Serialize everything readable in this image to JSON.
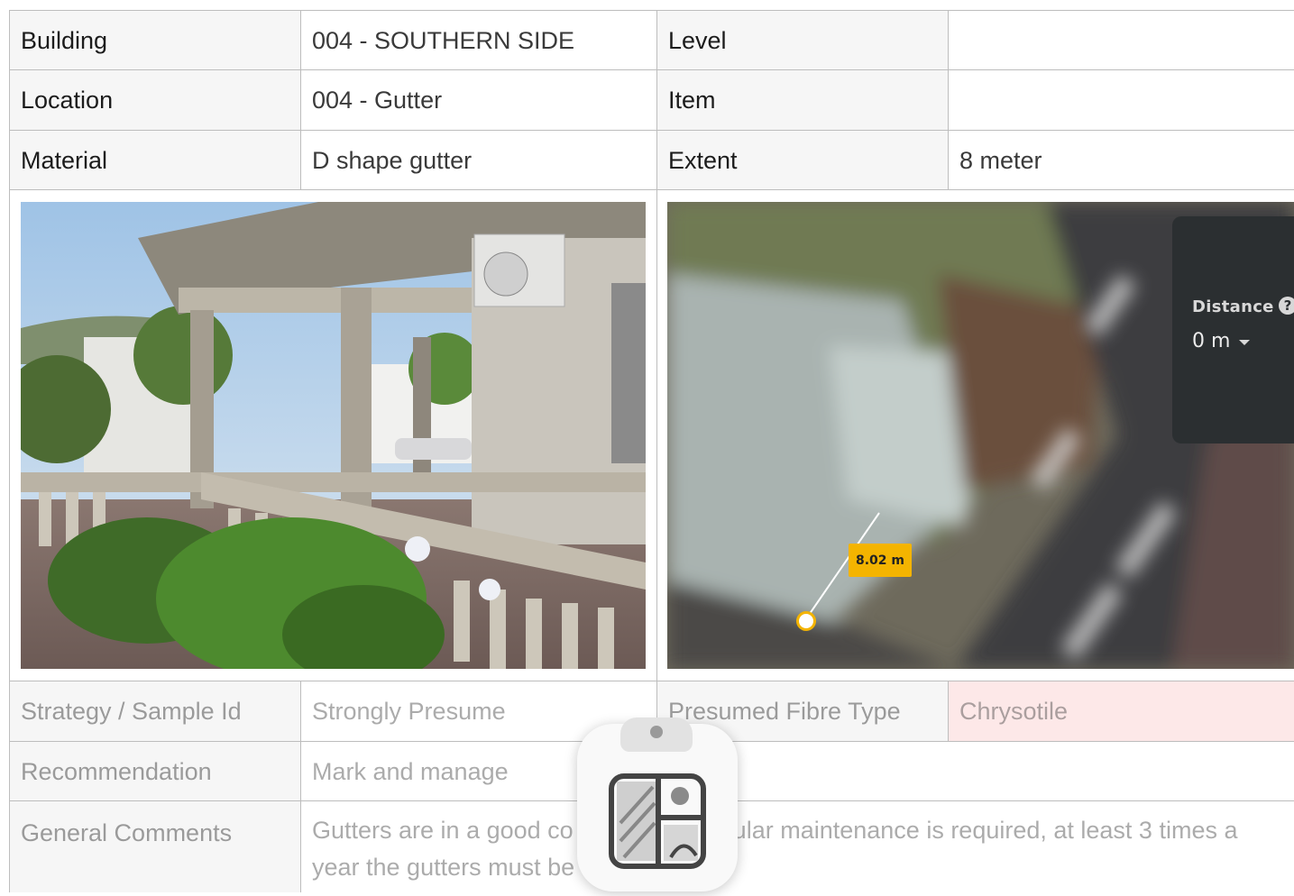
{
  "rows": [
    {
      "label1": "Building",
      "value1": "004 - SOUTHERN SIDE",
      "label2": "Level",
      "value2": ""
    },
    {
      "label1": "Location",
      "value1": "004 - Gutter",
      "label2": "Item",
      "value2": ""
    },
    {
      "label1": "Material",
      "value1": "D shape gutter",
      "label2": "Extent",
      "value2": "8 meter"
    }
  ],
  "map": {
    "distance_title": "Distance",
    "help_glyph": "?",
    "distance_value": "0 m",
    "measure_label": "8.02 m"
  },
  "strategy": {
    "label": "Strategy / Sample Id",
    "value": "Strongly Presume"
  },
  "fibre": {
    "label": "Presumed Fibre Type",
    "value": "Chrysotile",
    "highlight_color": "#fde8e8"
  },
  "recommendation": {
    "label": "Recommendation",
    "value": "Mark and manage"
  },
  "comments": {
    "label": "General Comments",
    "visible_text": "Gutters are in a good co            gular maintenance is required, at least 3 times a year the gutters must be"
  },
  "overlay": {
    "icon": "clipboard-gallery-icon"
  }
}
